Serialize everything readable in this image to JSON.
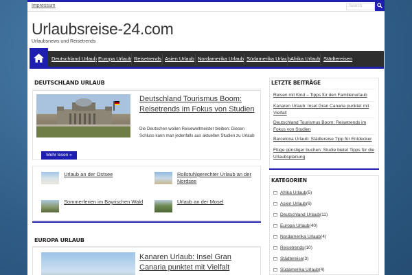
{
  "topbar": {
    "impressum": "Impressum",
    "search_placeholder": "Search"
  },
  "brand": {
    "logo": "Urlaubsreise-24.com",
    "tagline": "Urlaubsnews und Reisetrends",
    "accent": "#1e1eb0"
  },
  "nav": {
    "items": [
      "Deutschland Urlaub",
      "Europa Urlaub",
      "Reisetrends",
      "Asien Urlaub",
      "Nordamerika Urlaub",
      "Südamerika Urlaub",
      "Afrika Urlaub",
      "Städtereisen"
    ]
  },
  "deutschland": {
    "heading": "DEUTSCHLAND URLAUB",
    "featured_title": "Deutschland Tourismus Boom: Reisetrends im Fokus von Studien",
    "featured_excerpt": "Die Deutschen wollen Reiseweltmeister bleiben: Diesen Schluss kann man jedenfalls aus aktuellen Studien zu Urlaub",
    "more": "Mehr lesen »",
    "related": [
      "Urlaub an der Ostsee",
      "Rollstuhlgerechter Urlaub an der Nordsee",
      "Sommerferien im Bayrischen Wald",
      "Urlaub an der Mosel"
    ]
  },
  "europa": {
    "heading": "EUROPA URLAUB",
    "featured_title": "Kanaren Urlaub: Insel Gran Canaria punktet mit Vielfalt"
  },
  "sidebar": {
    "recent_heading": "LETZTE BEITRÄGE",
    "recent": [
      "Reisen mit Kind – Tipps für den Familienurlaub",
      "Kanaren Urlaub: Insel Gran Canaria punktet mit Vielfalt",
      "Deutschland Tourismus Boom: Reisetrends im Fokus von Studien",
      "Barcelona Urlaub: Städtereise Tipp für Entdecker",
      "Flüge günstiger buchen: Studie bietet Tipps für die Urlaubsplanung"
    ],
    "categories_heading": "KATEGORIEN",
    "categories": [
      {
        "name": "Afrika Urlaub",
        "count": "(5)"
      },
      {
        "name": "Asien Urlaub",
        "count": "(6)"
      },
      {
        "name": "Deutschland Urlaub",
        "count": "(11)"
      },
      {
        "name": "Europa Urlaub",
        "count": "(40)"
      },
      {
        "name": "Nordamerika Urlaub",
        "count": "(4)"
      },
      {
        "name": "Reisetrends",
        "count": "(10)"
      },
      {
        "name": "Städtereise",
        "count": "(3)"
      },
      {
        "name": "Südamerika Urlaub",
        "count": "(4)"
      }
    ]
  }
}
